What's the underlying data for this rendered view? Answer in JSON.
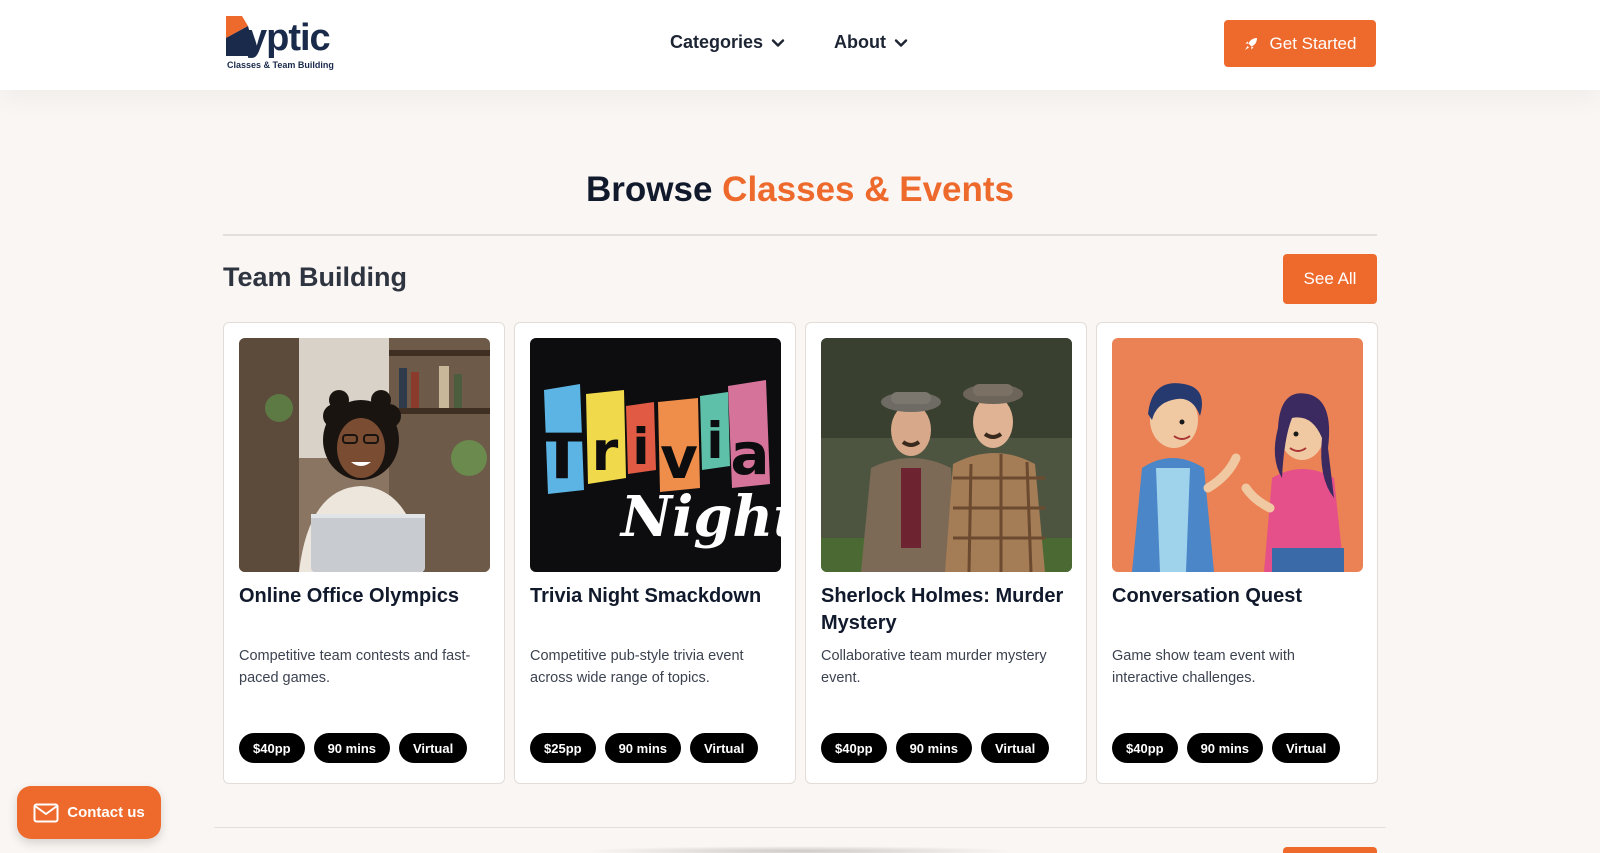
{
  "brand": {
    "logo_text": "yptic",
    "tagline": "Classes & Team Building",
    "accent": "#ee6a2c",
    "navy": "#1a2a4a"
  },
  "nav": {
    "categories": "Categories",
    "about": "About",
    "cta": "Get Started",
    "cta_icon": "rocket-icon"
  },
  "section": {
    "title_main": "Browse",
    "title_accent": "Classes & Events"
  },
  "category": {
    "title": "Team Building",
    "see_all": "See All"
  },
  "cards": [
    {
      "title": "Online Office Olympics",
      "description": "Competitive team contests and fast-paced games.",
      "tags": [
        "$40pp",
        "90 mins",
        "Virtual"
      ]
    },
    {
      "title": "Trivia Night Smackdown",
      "description": "Competitive pub-style trivia event across wide range of topics.",
      "tags": [
        "$25pp",
        "90 mins",
        "Virtual"
      ]
    },
    {
      "title": "Sherlock Holmes: Murder Mystery",
      "description": "Collaborative team murder mystery event.",
      "tags": [
        "$40pp",
        "90 mins",
        "Virtual"
      ]
    },
    {
      "title": "Conversation Quest",
      "description": "Game show team event with interactive challenges.",
      "tags": [
        "$40pp",
        "90 mins",
        "Virtual"
      ]
    }
  ],
  "contact": {
    "label": "Contact us",
    "icon": "mail-icon"
  }
}
